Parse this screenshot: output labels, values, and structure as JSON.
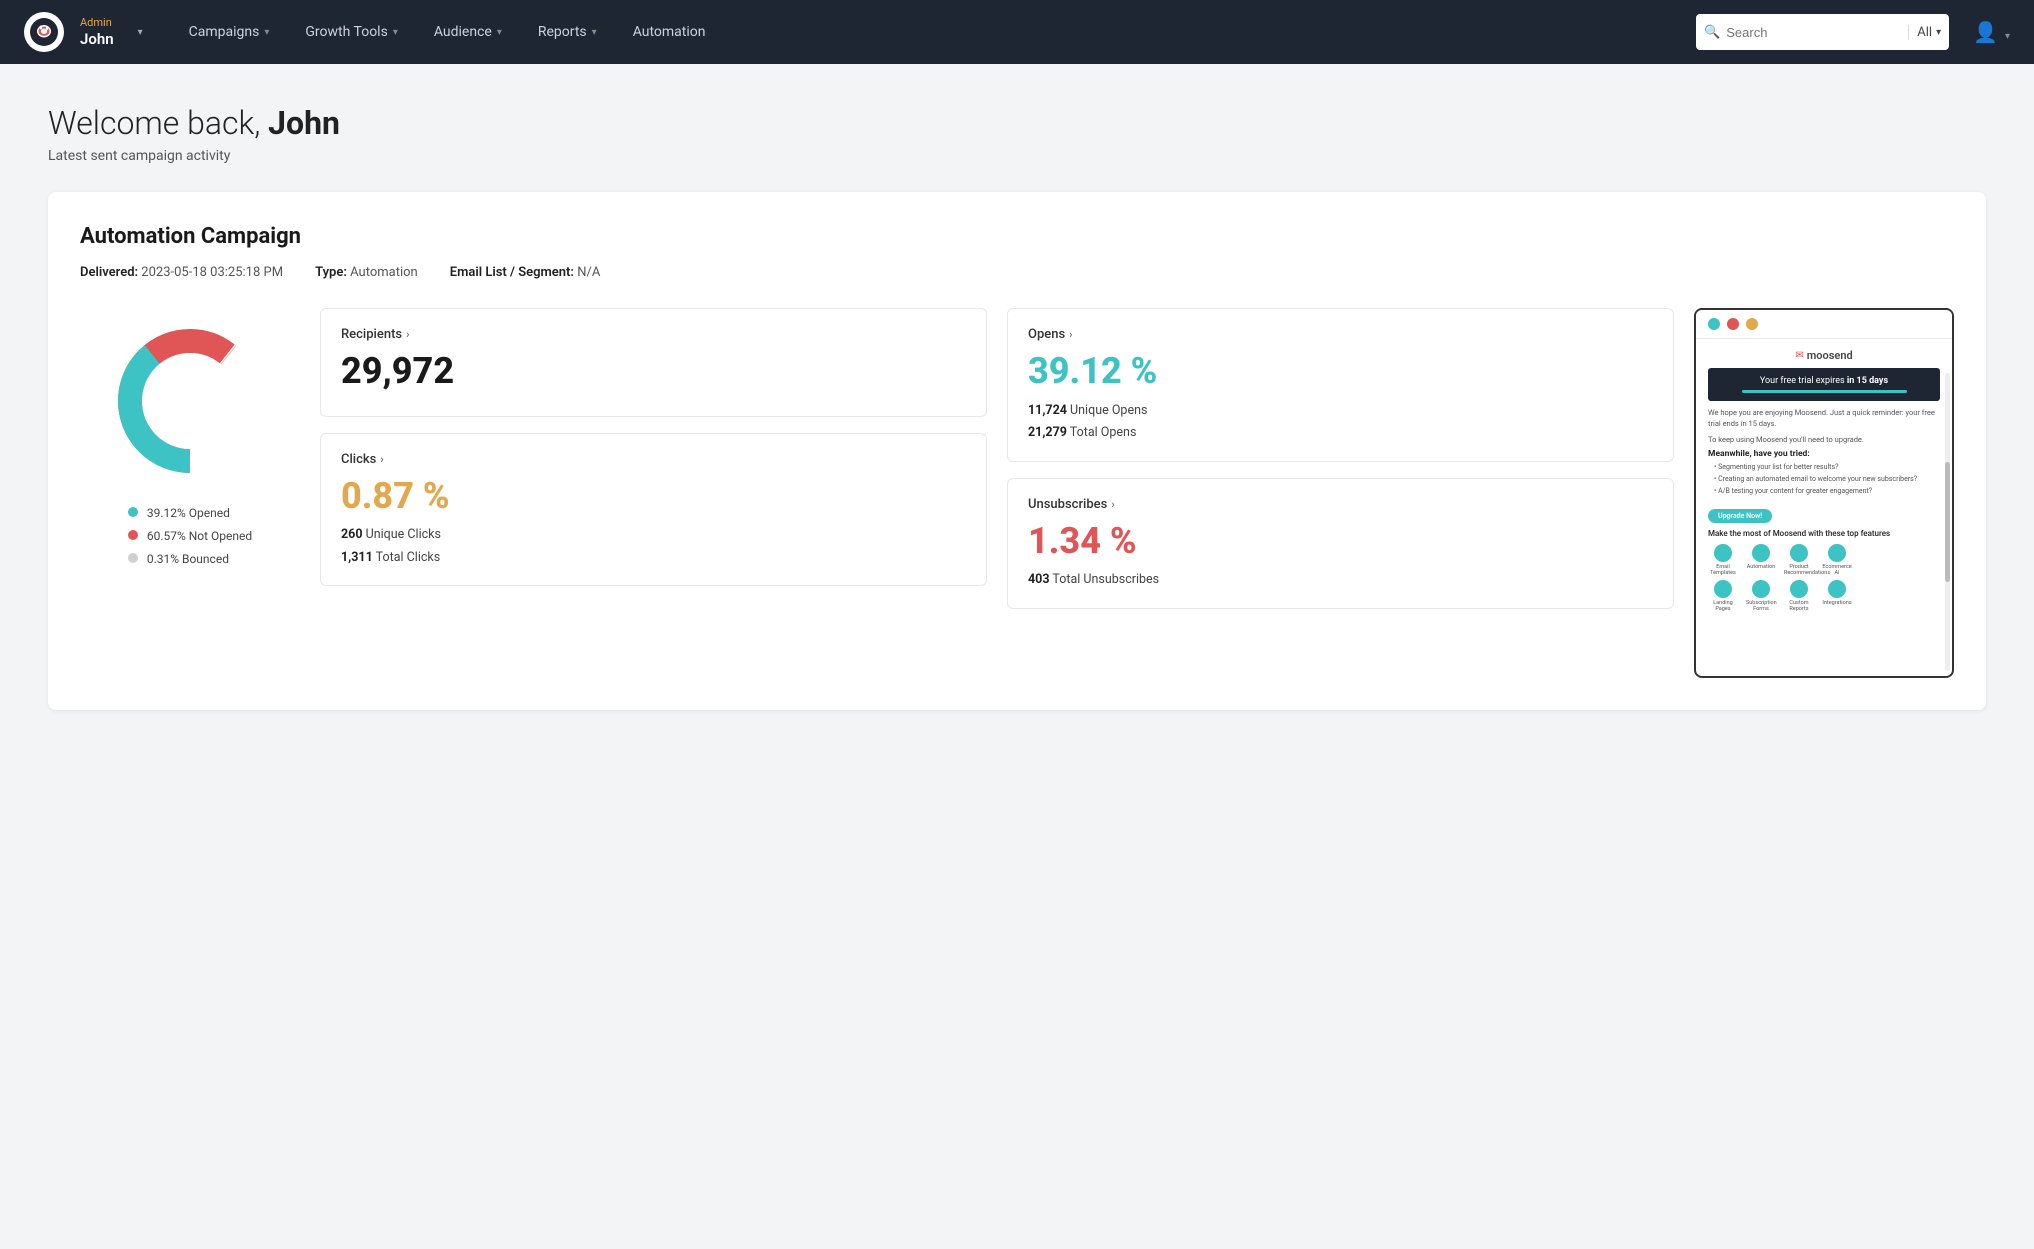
{
  "nav": {
    "admin_label": "Admin",
    "user_name": "John",
    "campaigns_label": "Campaigns",
    "growth_tools_label": "Growth Tools",
    "audience_label": "Audience",
    "reports_label": "Reports",
    "automation_label": "Automation",
    "search_placeholder": "Search",
    "search_filter": "All",
    "profile_icon": "👤"
  },
  "welcome": {
    "greeting": "Welcome back, ",
    "user_name": "John",
    "subtitle": "Latest sent campaign activity"
  },
  "campaign": {
    "title": "Automation Campaign",
    "delivered_label": "Delivered:",
    "delivered_value": "2023-05-18 03:25:18 PM",
    "type_label": "Type:",
    "type_value": "Automation",
    "email_list_label": "Email List / Segment:",
    "email_list_value": "N/A"
  },
  "donut": {
    "segments": [
      {
        "label": "39.12% Opened",
        "color": "#3dc3c3",
        "value": 39.12
      },
      {
        "label": "60.57% Not Opened",
        "color": "#e05555",
        "value": 60.57
      },
      {
        "label": "0.31% Bounced",
        "color": "#d0d0d0",
        "value": 0.31
      }
    ]
  },
  "stats": {
    "recipients": {
      "label": "Recipients",
      "value": "29,972"
    },
    "opens": {
      "label": "Opens",
      "percent": "39.12 %",
      "unique_label": "Unique Opens",
      "unique_value": "11,724",
      "total_label": "Total Opens",
      "total_value": "21,279"
    },
    "clicks": {
      "label": "Clicks",
      "percent": "0.87 %",
      "unique_label": "Unique Clicks",
      "unique_value": "260",
      "total_label": "Total Clicks",
      "total_value": "1,311"
    },
    "unsubscribes": {
      "label": "Unsubscribes",
      "percent": "1.34 %",
      "total_label": "Total Unsubscribes",
      "total_value": "403"
    }
  },
  "email_preview": {
    "logo_text": "moosend",
    "banner_text_before": "Your free trial expires ",
    "banner_bold": "in 15 days",
    "body_text1": "We hope you are enjoying Moosend. Just a quick reminder: your free trial ends in 15 days.",
    "body_text2": "To keep using Moosend you'll need to upgrade.",
    "meanwhile_heading": "Meanwhile, have you tried:",
    "list_items": [
      "• Segmenting your list for better results?",
      "• Creating an automated email to welcome your new subscribers?",
      "• A/B testing your content for greater engagement?"
    ],
    "btn_label": "Upgrade Now!",
    "features_heading": "Make the most of Moosend with these top features",
    "feature_icons": [
      "Email Templates",
      "Automation",
      "Product Recommendations",
      "Ecommerce AI",
      "Landing Pages",
      "Subscription Forms",
      "Custom Reports",
      "Integrations"
    ]
  }
}
